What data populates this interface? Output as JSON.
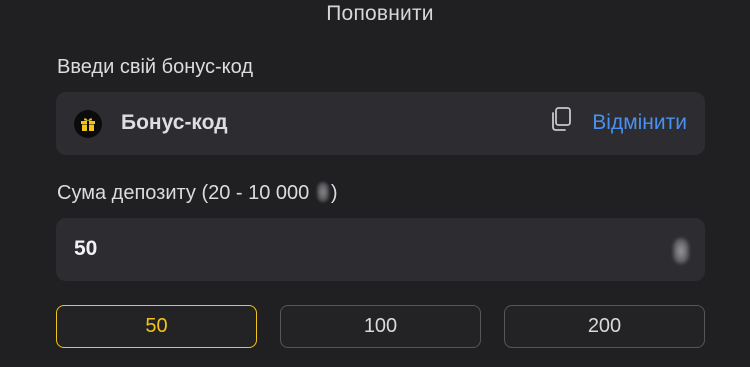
{
  "header": {
    "title": "Поповнити"
  },
  "bonus": {
    "label": "Введи свій бонус-код",
    "code_text": "Бонус-код",
    "cancel_label": "Відмінити",
    "icons": [
      "gift-icon",
      "copy-icon"
    ],
    "gift_badge_color": "#0b0b0c",
    "gift_icon_color": "#f2c318"
  },
  "amount": {
    "label": "Сума депозиту (20 - 10 000 ",
    "label_suffix": ")",
    "value": "50"
  },
  "quick_amounts": [
    {
      "label": "50",
      "active": true
    },
    {
      "label": "100",
      "active": false
    },
    {
      "label": "200",
      "active": false
    }
  ],
  "colors": {
    "background": "#202023",
    "field": "#2d2d31",
    "accent_yellow": "#f2c318",
    "link_blue": "#4a90f0"
  }
}
